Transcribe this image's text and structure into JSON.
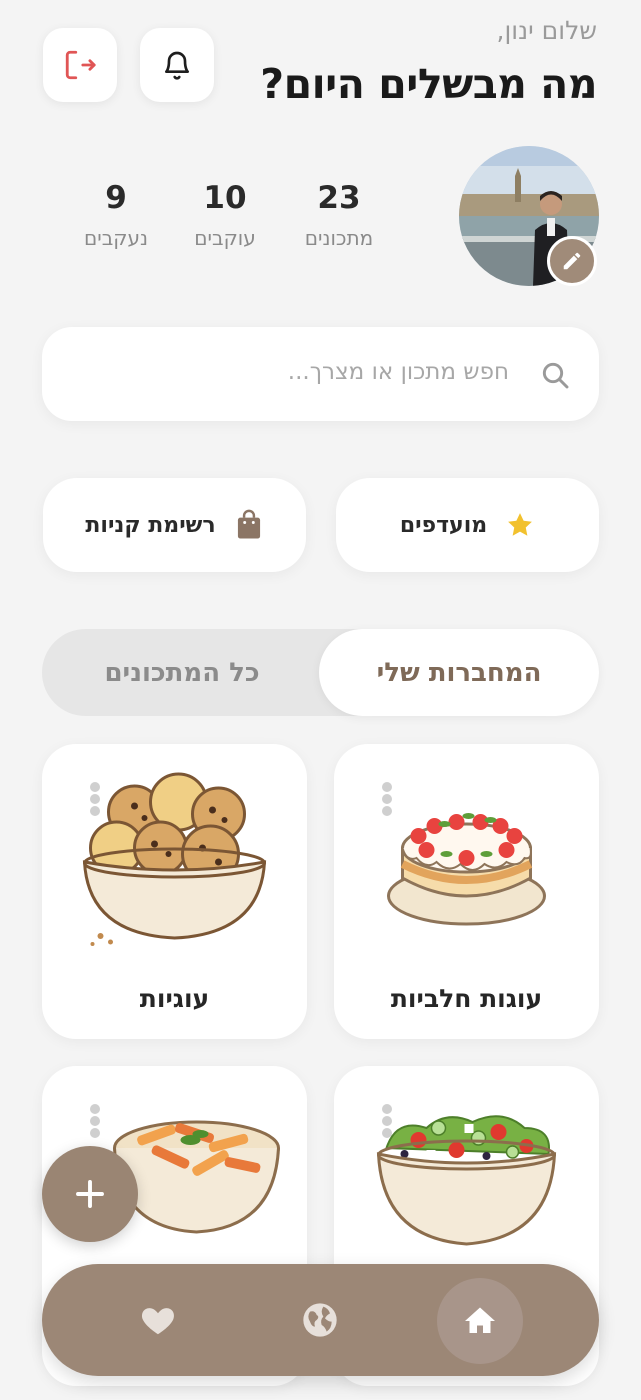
{
  "header": {
    "greeting": "שלום ינון,",
    "title": "מה מבשלים היום?"
  },
  "profile": {
    "stats": [
      {
        "value": "23",
        "label": "מתכונים"
      },
      {
        "value": "10",
        "label": "עוקבים"
      },
      {
        "value": "9",
        "label": "נעקבים"
      }
    ]
  },
  "search": {
    "placeholder": "חפש מתכון או מצרך..."
  },
  "quick_actions": {
    "favorites_label": "מועדפים",
    "shopping_label": "רשימת קניות"
  },
  "tabs": {
    "mine": "המחברות שלי",
    "all": "כל המתכונים"
  },
  "cards": [
    {
      "title": "עוגות חלביות",
      "icon": "cake-icon"
    },
    {
      "title": "עוגיות",
      "icon": "cookies-bowl-icon"
    },
    {
      "title": "",
      "icon": "salad-bowl-icon"
    },
    {
      "title": "",
      "icon": "pasta-bowl-icon"
    }
  ],
  "colors": {
    "accent": "#9c8776",
    "accent_text": "#7f6a58",
    "star": "#f2c12e",
    "logout": "#e05555",
    "background": "#f4f4f4"
  },
  "nav": {
    "items": [
      "home-icon",
      "globe-icon",
      "heart-icon"
    ],
    "active": "home-icon"
  }
}
